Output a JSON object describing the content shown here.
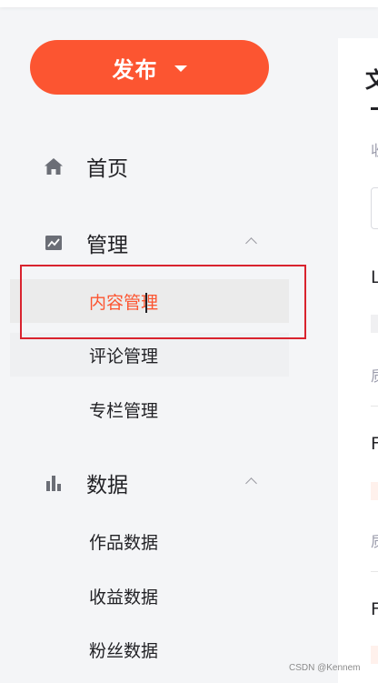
{
  "publish": {
    "label": "发布"
  },
  "sidebar": {
    "items": [
      {
        "label": "首页",
        "icon": "home-icon"
      },
      {
        "label": "管理",
        "icon": "chart-icon",
        "expanded": true,
        "children": [
          {
            "label": "内容管理",
            "active": true
          },
          {
            "label": "评论管理"
          },
          {
            "label": "专栏管理"
          }
        ]
      },
      {
        "label": "数据",
        "icon": "bar-chart-icon",
        "expanded": true,
        "children": [
          {
            "label": "作品数据"
          },
          {
            "label": "收益数据"
          },
          {
            "label": "粉丝数据"
          }
        ]
      }
    ]
  },
  "content": {
    "title": "文",
    "subtitle": "收",
    "rows": [
      {
        "title": "L",
        "meta": "质"
      },
      {
        "title": "F",
        "meta": "质"
      },
      {
        "title": "F"
      }
    ]
  },
  "colors": {
    "accent": "#fc5531",
    "annotation": "#d9232e",
    "sidebar_bg": "#f4f5f7"
  },
  "watermark": "CSDN @Kennem"
}
